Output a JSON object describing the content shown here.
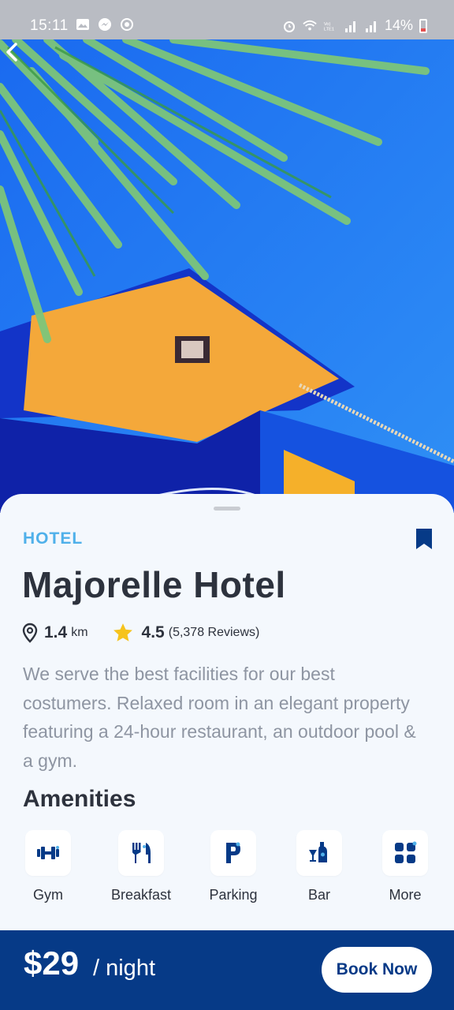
{
  "status_bar": {
    "time": "15:11",
    "battery": "14%",
    "icons": [
      "gallery-icon",
      "messenger-icon",
      "sync-icon",
      "alarm-icon",
      "wifi-icon",
      "volte-icon",
      "signal-icon",
      "signal-icon",
      "battery-icon"
    ]
  },
  "hero": {
    "back_icon": "chevron-left-icon"
  },
  "hotel": {
    "category": "HOTEL",
    "name": "Majorelle Hotel",
    "distance_value": "1.4",
    "distance_unit": "km",
    "rating": "4.5",
    "reviews": "(5,378 Reviews)",
    "description": "We serve the best facilities for our best costumers. Relaxed room in an elegant property featuring a 24-hour restaurant, an outdoor pool & a gym.",
    "bookmark_icon": "bookmark-icon"
  },
  "amenities": {
    "title": "Amenities",
    "items": [
      {
        "label": "Gym",
        "icon": "dumbbell-icon"
      },
      {
        "label": "Breakfast",
        "icon": "cutlery-icon"
      },
      {
        "label": "Parking",
        "icon": "parking-icon"
      },
      {
        "label": "Bar",
        "icon": "bar-icon"
      },
      {
        "label": "More",
        "icon": "grid-icon"
      }
    ]
  },
  "footer": {
    "price": "$29",
    "per": "/ night",
    "book_label": "Book Now"
  },
  "colors": {
    "accent_light": "#4fb0ea",
    "primary_dark": "#063a87",
    "star": "#f6c31c",
    "text_dark": "#2d323d",
    "text_muted": "#8e95a2"
  }
}
